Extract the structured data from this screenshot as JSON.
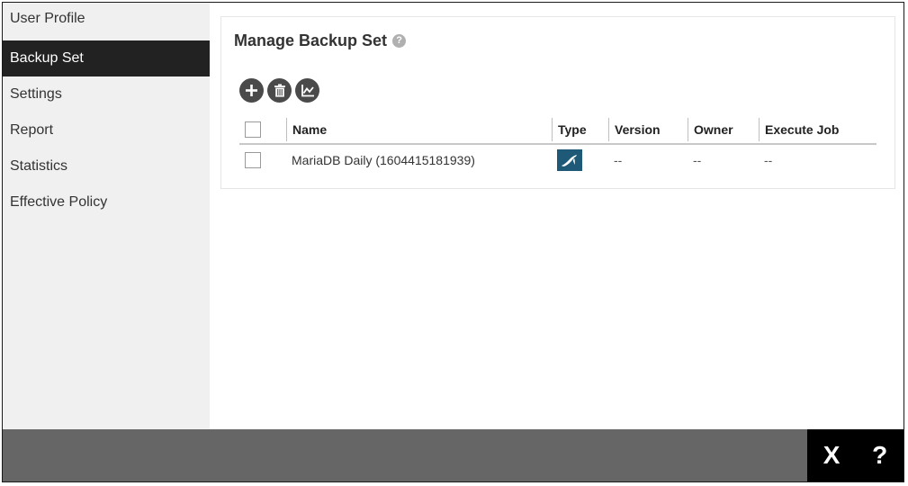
{
  "sidebar": {
    "items": [
      {
        "label": "User Profile",
        "active": false
      },
      {
        "label": "Backup Set",
        "active": true
      },
      {
        "label": "Settings",
        "active": false
      },
      {
        "label": "Report",
        "active": false
      },
      {
        "label": "Statistics",
        "active": false
      },
      {
        "label": "Effective Policy",
        "active": false
      }
    ]
  },
  "panel": {
    "title": "Manage Backup Set",
    "help_icon": "question-circle-icon",
    "help_glyph": "?",
    "toolbar": {
      "add_icon": "plus-icon",
      "delete_icon": "trash-icon",
      "report_icon": "line-chart-icon"
    }
  },
  "table": {
    "columns": [
      "Name",
      "Type",
      "Version",
      "Owner",
      "Execute Job"
    ],
    "rows": [
      {
        "name": "MariaDB Daily (1604415181939)",
        "type_icon": "mariadb-seal-icon",
        "version": "--",
        "owner": "--",
        "execute_job": "--"
      }
    ]
  },
  "footer": {
    "close_label": "X",
    "help_label": "?"
  },
  "colors": {
    "active_sidebar_bg": "#222222",
    "footer_bg": "#666666",
    "footer_right_bg": "#000000",
    "type_icon_bg": "#1e5a78",
    "toolbar_btn_bg": "#4a4a4a"
  }
}
